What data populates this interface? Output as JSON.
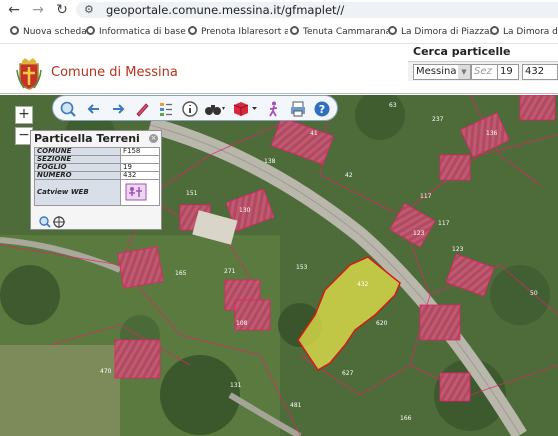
{
  "browser": {
    "url": "geoportale.comune.messina.it/gfmaplet//",
    "bookmarks": [
      {
        "label": "Nuova scheda"
      },
      {
        "label": "Informatica di base:..."
      },
      {
        "label": "Prenota Iblaresort a..."
      },
      {
        "label": "Tenuta Cammarana..."
      },
      {
        "label": "La Dimora di Piazza..."
      },
      {
        "label": "La Dimora di Spa"
      }
    ]
  },
  "header": {
    "title": "Comune di Messina"
  },
  "cerca": {
    "title": "Cerca particelle",
    "comune_value": "Messina",
    "sez_placeholder": "Sez",
    "foglio_value": "19",
    "numero_value": "432"
  },
  "toolbar": {
    "icons": [
      "search-zoom-icon",
      "back-arrow-icon",
      "forward-arrow-icon",
      "pen-icon",
      "legend-icon",
      "info-icon",
      "binoculars-icon",
      "layers-cube-icon",
      "walk-icon",
      "print-icon",
      "help-icon"
    ]
  },
  "info": {
    "title": "Particella Terreni",
    "rows": [
      {
        "key": "COMUNE",
        "value": "F158"
      },
      {
        "key": "SEZIONE",
        "value": ""
      },
      {
        "key": "FOGLIO",
        "value": "19"
      },
      {
        "key": "NUMERO",
        "value": "432"
      }
    ],
    "catview_label": "Catview WEB"
  },
  "map": {
    "parcel_labels": [
      "63",
      "237",
      "41",
      "42",
      "136",
      "138",
      "130",
      "123",
      "117",
      "117",
      "153",
      "271",
      "432",
      "620",
      "627",
      "481",
      "470",
      "165",
      "50",
      "131",
      "123",
      "108",
      "151",
      "166"
    ]
  },
  "colors": {
    "brand_red": "#b8311b",
    "highlight_parcel": "#e7e64b",
    "parcel_outline": "#e8206a",
    "panel_bg": "#f5f5f5"
  }
}
